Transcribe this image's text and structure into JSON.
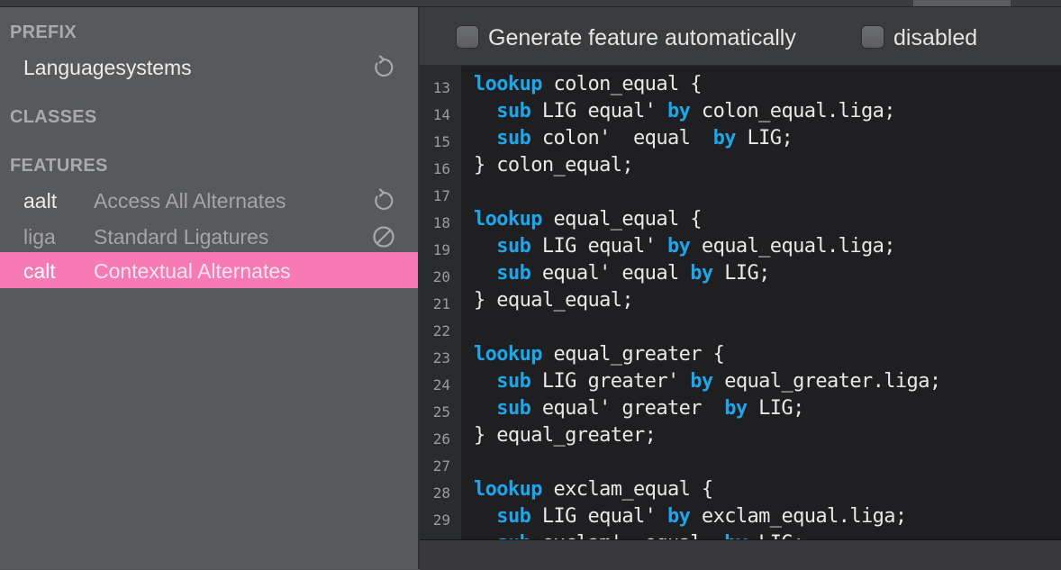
{
  "sidebar": {
    "prefix_header": "PREFIX",
    "prefix_item": "Languagesystems",
    "classes_header": "CLASSES",
    "features_header": "FEATURES",
    "features": [
      {
        "tag": "aalt",
        "name": "Access All Alternates",
        "icon": "refresh-icon"
      },
      {
        "tag": "liga",
        "name": "Standard Ligatures",
        "icon": "disabled-icon"
      },
      {
        "tag": "calt",
        "name": "Contextual Alternates",
        "icon": ""
      }
    ]
  },
  "toolbar": {
    "generate_label": "Generate feature automatically",
    "disabled_label": "disabled"
  },
  "editor": {
    "line_numbers": [
      "13",
      "14",
      "15",
      "16",
      "17",
      "18",
      "19",
      "20",
      "21",
      "22",
      "23",
      "24",
      "25",
      "26",
      "27",
      "28",
      "29"
    ],
    "lines": [
      [
        {
          "t": "lookup",
          "k": true
        },
        {
          "t": " colon_equal {"
        }
      ],
      [
        {
          "t": "  "
        },
        {
          "t": "sub",
          "k": true
        },
        {
          "t": " LIG equal' "
        },
        {
          "t": "by",
          "k": true
        },
        {
          "t": " colon_equal.liga;"
        }
      ],
      [
        {
          "t": "  "
        },
        {
          "t": "sub",
          "k": true
        },
        {
          "t": " colon'  equal  "
        },
        {
          "t": "by",
          "k": true
        },
        {
          "t": " LIG;"
        }
      ],
      [
        {
          "t": "} colon_equal;"
        }
      ],
      [],
      [
        {
          "t": "lookup",
          "k": true
        },
        {
          "t": " equal_equal {"
        }
      ],
      [
        {
          "t": "  "
        },
        {
          "t": "sub",
          "k": true
        },
        {
          "t": " LIG equal' "
        },
        {
          "t": "by",
          "k": true
        },
        {
          "t": " equal_equal.liga;"
        }
      ],
      [
        {
          "t": "  "
        },
        {
          "t": "sub",
          "k": true
        },
        {
          "t": " equal' equal "
        },
        {
          "t": "by",
          "k": true
        },
        {
          "t": " LIG;"
        }
      ],
      [
        {
          "t": "} equal_equal;"
        }
      ],
      [],
      [
        {
          "t": "lookup",
          "k": true
        },
        {
          "t": " equal_greater {"
        }
      ],
      [
        {
          "t": "  "
        },
        {
          "t": "sub",
          "k": true
        },
        {
          "t": " LIG greater' "
        },
        {
          "t": "by",
          "k": true
        },
        {
          "t": " equal_greater.liga;"
        }
      ],
      [
        {
          "t": "  "
        },
        {
          "t": "sub",
          "k": true
        },
        {
          "t": " equal' greater  "
        },
        {
          "t": "by",
          "k": true
        },
        {
          "t": " LIG;"
        }
      ],
      [
        {
          "t": "} equal_greater;"
        }
      ],
      [],
      [
        {
          "t": "lookup",
          "k": true
        },
        {
          "t": " exclam_equal {"
        }
      ],
      [
        {
          "t": "  "
        },
        {
          "t": "sub",
          "k": true
        },
        {
          "t": " LIG equal' "
        },
        {
          "t": "by",
          "k": true
        },
        {
          "t": " exclam_equal.liga;"
        }
      ],
      [
        {
          "t": "  "
        },
        {
          "t": "sub",
          "k": true
        },
        {
          "t": " exclam'  equal  "
        },
        {
          "t": "by",
          "k": true
        },
        {
          "t": " LIG;"
        }
      ]
    ]
  },
  "colors": {
    "accent_selected": "#f77ab4",
    "keyword": "#1ea6ea",
    "sidebar_bg": "#58595b",
    "editor_bg": "#1f1f21"
  }
}
